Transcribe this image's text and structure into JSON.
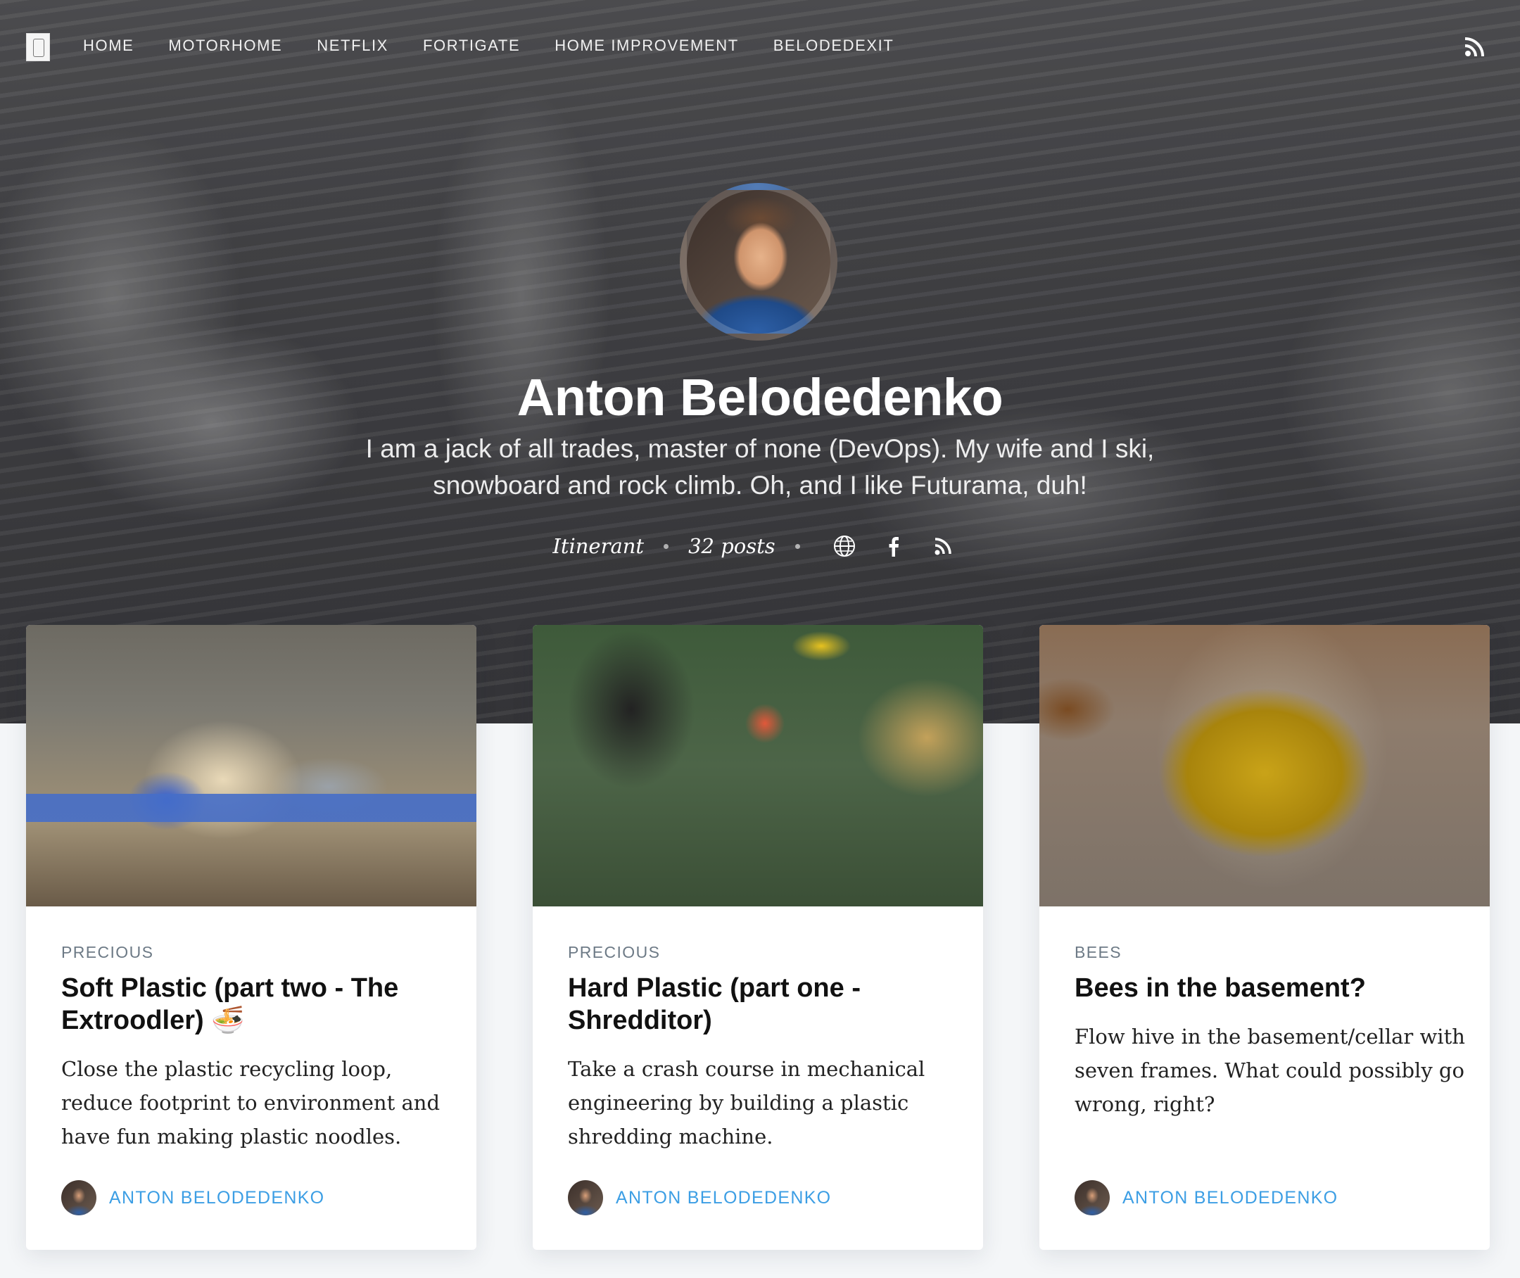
{
  "nav": {
    "logo_icon": "site-logo-icon",
    "links": [
      "Home",
      "Motorhome",
      "Netflix",
      "Fortigate",
      "Home Improvement",
      "BelodedExit"
    ],
    "rss_icon": "rss-icon"
  },
  "profile": {
    "name": "Anton Belodedenko",
    "bio": "I am a jack of all trades, master of none (DevOps). My wife and I ski, snowboard and rock climb. Oh, and I like Futurama, duh!",
    "location": "Itinerant",
    "posts": "32 posts",
    "icons": [
      "globe-icon",
      "facebook-icon",
      "rss-icon"
    ]
  },
  "cards": [
    {
      "tag": "Precious",
      "title": "Soft Plastic (part two - The Extroodler) 🍜",
      "excerpt": "Close the plastic recycling loop, reduce footprint to environment and have fun making plastic noodles.",
      "author": "Anton Belodedenko"
    },
    {
      "tag": "Precious",
      "title": "Hard Plastic (part one - Shredditor)",
      "excerpt": "Take a crash course in mechanical engineering by building a plastic shredding machine.",
      "author": "Anton Belodedenko"
    },
    {
      "tag": "Bees",
      "title": "Bees in the basement?",
      "excerpt": "Flow hive in the basement/cellar with seven frames. What could possibly go wrong, right?",
      "author": "Anton Belodedenko"
    }
  ],
  "colors": {
    "accent": "#3c9ee4",
    "background": "#f4f6f8",
    "card": "#ffffff"
  }
}
